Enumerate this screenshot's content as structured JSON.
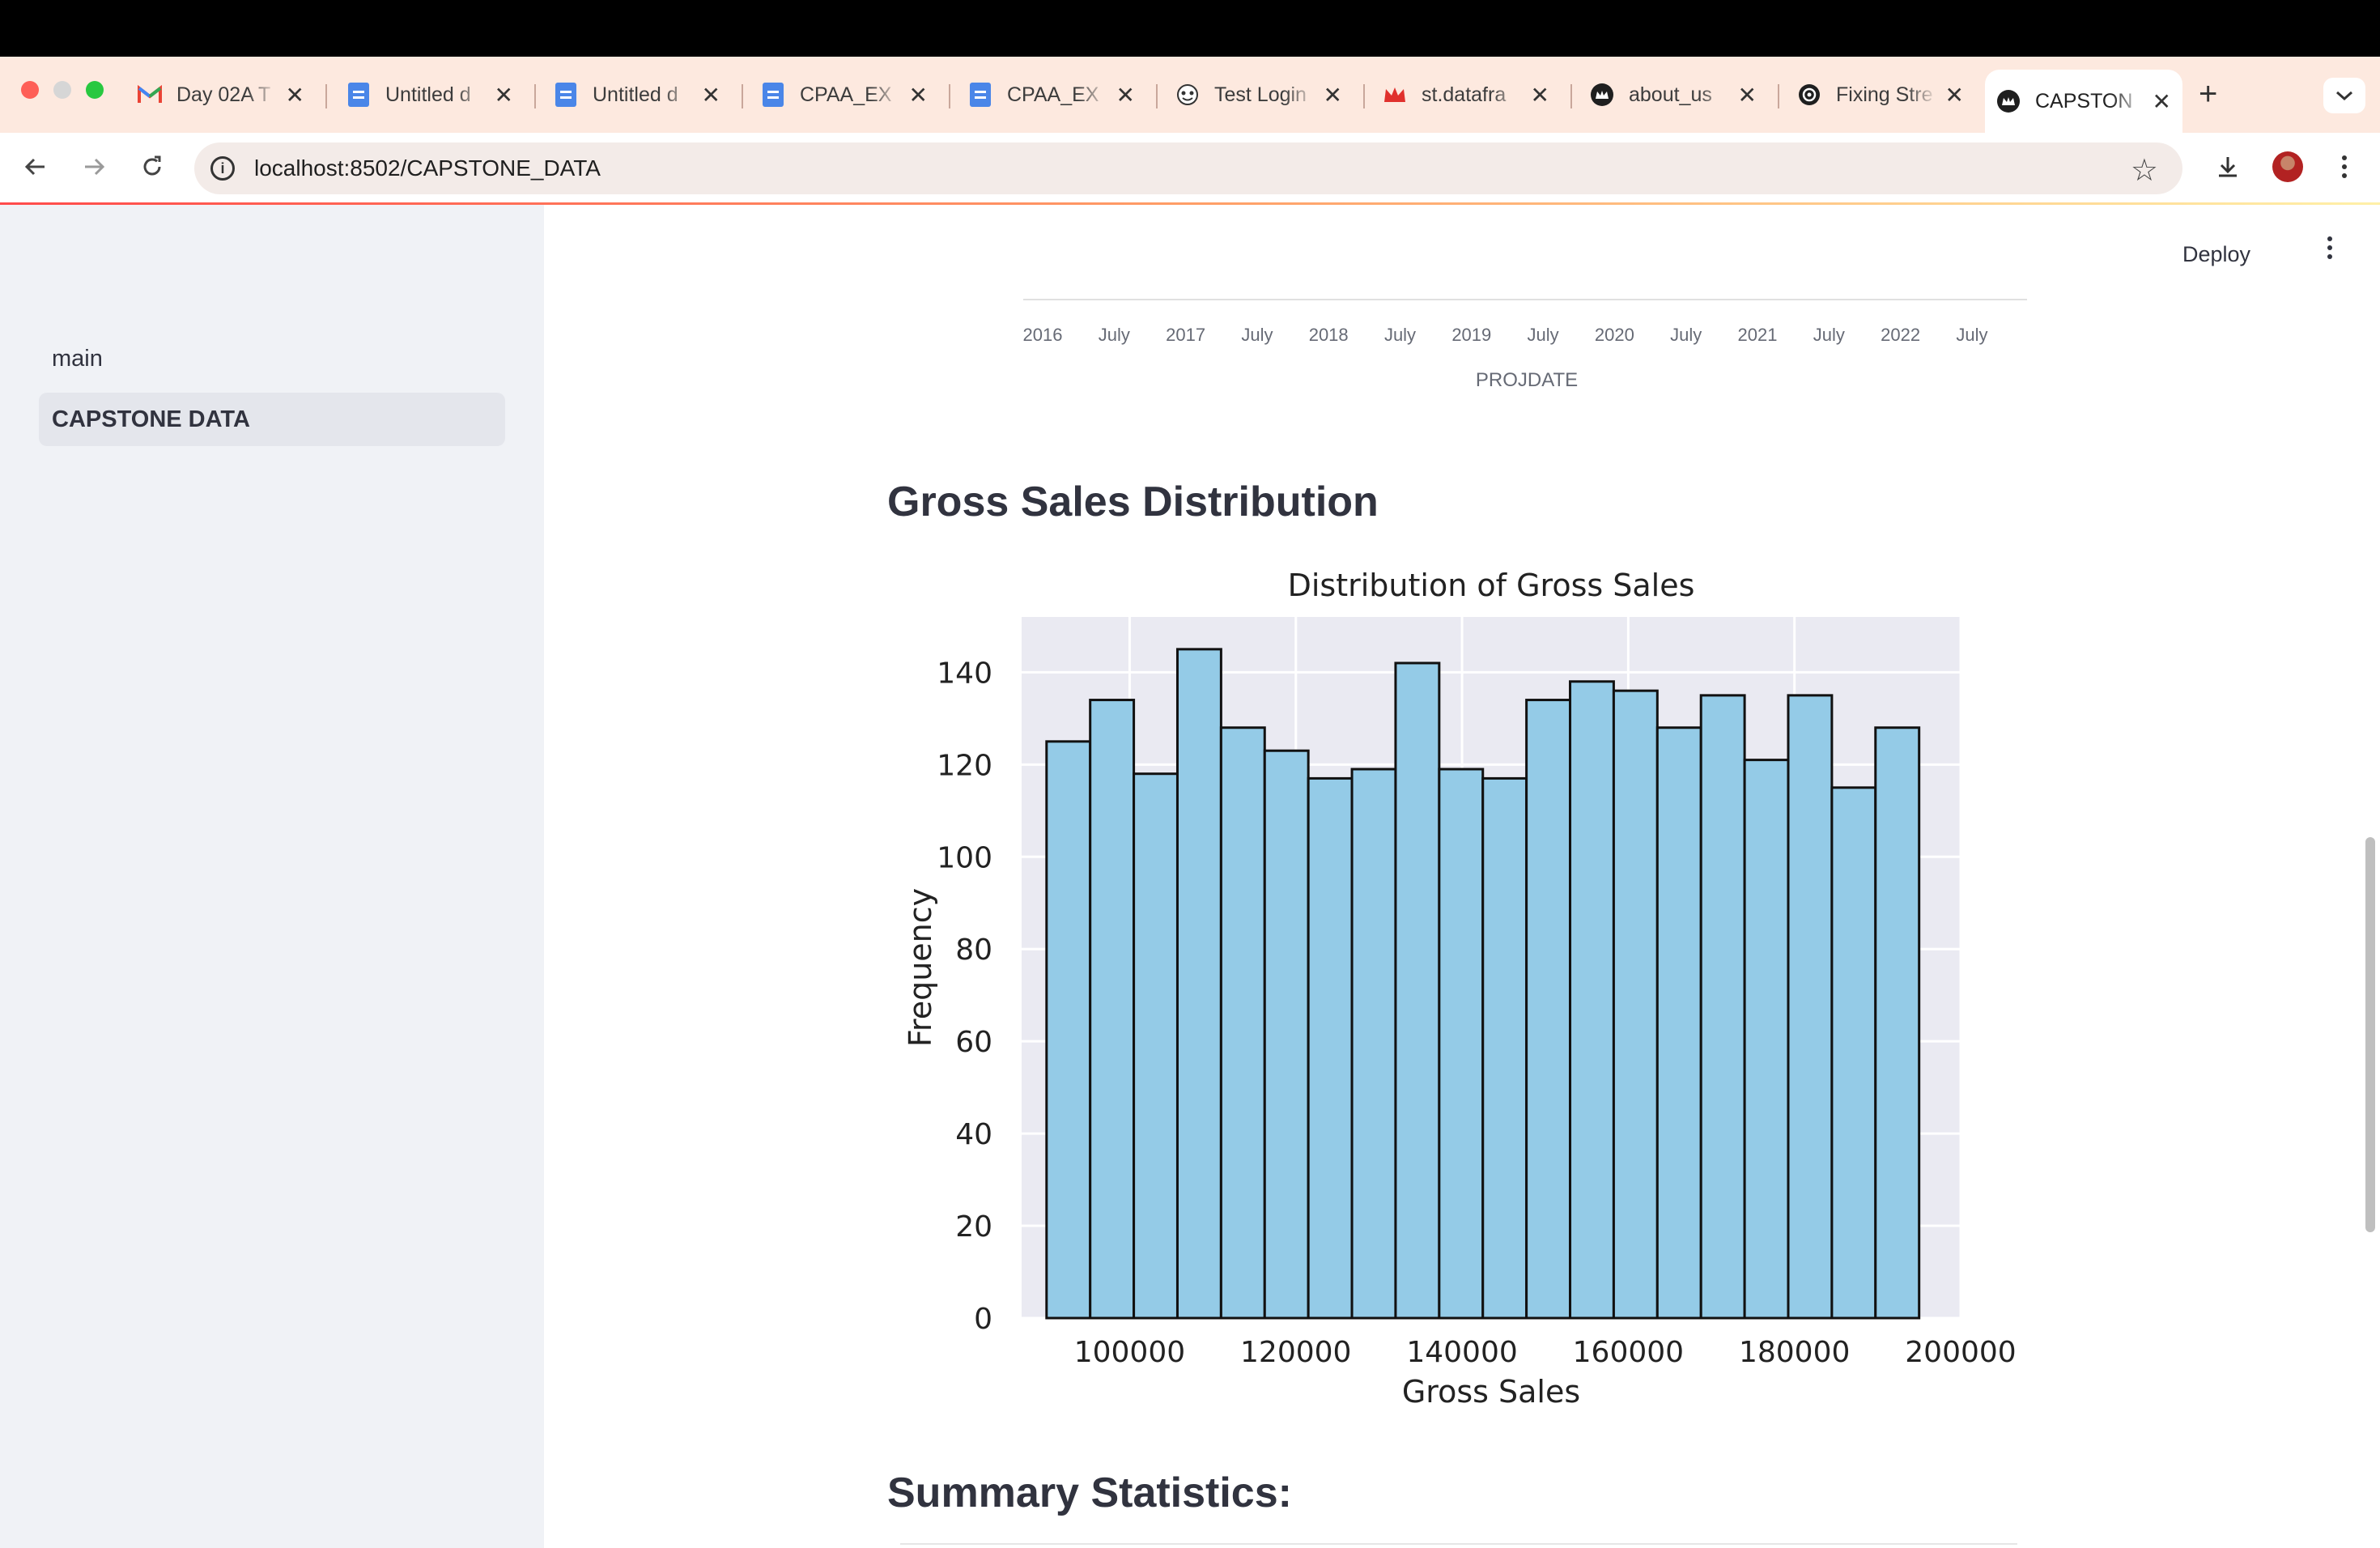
{
  "browser": {
    "tabs": [
      {
        "title": "Day 02A T",
        "icon": "gmail-icon",
        "active": false
      },
      {
        "title": "Untitled d",
        "icon": "google-docs-icon",
        "active": false
      },
      {
        "title": "Untitled d",
        "icon": "google-docs-icon",
        "active": false
      },
      {
        "title": "CPAA_EX",
        "icon": "google-docs-icon",
        "active": false
      },
      {
        "title": "CPAA_EX",
        "icon": "google-docs-icon",
        "active": false
      },
      {
        "title": "Test Login",
        "icon": "mask-icon",
        "active": false
      },
      {
        "title": "st.datafra",
        "icon": "crown-icon",
        "active": false
      },
      {
        "title": "about_us",
        "icon": "streamlit-icon",
        "active": false
      },
      {
        "title": "Fixing Stre",
        "icon": "openai-icon",
        "active": false
      },
      {
        "title": "CAPSTON",
        "icon": "streamlit-icon",
        "active": true
      }
    ],
    "close_glyph": "✕",
    "url": "localhost:8502/CAPSTONE_DATA"
  },
  "sidebar": {
    "items": [
      {
        "label": "main",
        "active": false
      },
      {
        "label": "CAPSTONE DATA",
        "active": true
      }
    ]
  },
  "header": {
    "deploy_label": "Deploy"
  },
  "prev_chart": {
    "tick_labels": [
      "2016",
      "July",
      "2017",
      "July",
      "2018",
      "July",
      "2019",
      "July",
      "2020",
      "July",
      "2021",
      "July",
      "2022",
      "July"
    ],
    "xlabel": "PROJDATE"
  },
  "sections": {
    "gross_sales_heading": "Gross Sales Distribution",
    "summary_heading": "Summary Statistics:"
  },
  "chart_data": {
    "type": "bar",
    "title": "Distribution of Gross Sales",
    "xlabel": "Gross Sales",
    "ylabel": "Frequency",
    "bin_start": 90000,
    "bin_width": 5250,
    "values": [
      125,
      134,
      118,
      145,
      128,
      123,
      117,
      119,
      142,
      119,
      117,
      134,
      138,
      136,
      128,
      135,
      121,
      135,
      115,
      128
    ],
    "xlim": [
      87000,
      200000
    ],
    "ylim": [
      0,
      152
    ],
    "xticks": [
      100000,
      120000,
      140000,
      160000,
      180000,
      200000
    ],
    "yticks": [
      0,
      20,
      40,
      60,
      80,
      100,
      120,
      140
    ],
    "grid": true,
    "bar_color": "#94cbe7",
    "edge_color": "#111111",
    "background": "#eaeaf2"
  }
}
